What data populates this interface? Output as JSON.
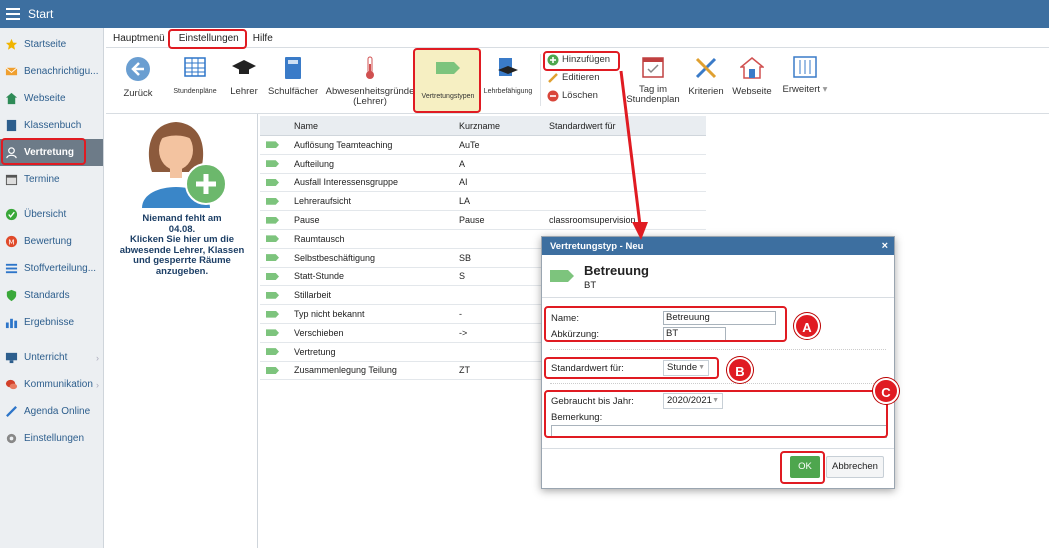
{
  "topbar": {
    "title": "Start"
  },
  "sidebar": {
    "items": [
      {
        "label": "Startseite",
        "icon": "star-icon",
        "color": "#f0b400"
      },
      {
        "label": "Benachrichtigu...",
        "icon": "mail-icon",
        "color": "#f0a030"
      },
      {
        "label": "Webseite",
        "icon": "home-icon",
        "color": "#2e8b57"
      },
      {
        "label": "Klassenbuch",
        "icon": "book-icon",
        "color": "#2d5e8d"
      },
      {
        "label": "Vertretung",
        "icon": "user-icon",
        "color": "#ffffff"
      },
      {
        "label": "Termine",
        "icon": "calendar-icon",
        "color": "#555555"
      },
      {
        "label": "Übersicht",
        "icon": "check-circle-icon",
        "color": "#3aa83a"
      },
      {
        "label": "Bewertung",
        "icon": "rating-icon",
        "color": "#e04a2a"
      },
      {
        "label": "Stoffverteilung...",
        "icon": "list-icon",
        "color": "#2d75c9"
      },
      {
        "label": "Standards",
        "icon": "shield-icon",
        "color": "#3aa83a"
      },
      {
        "label": "Ergebnisse",
        "icon": "bar-chart-icon",
        "color": "#2d75c9"
      },
      {
        "label": "Unterricht",
        "icon": "teaching-icon",
        "color": "#2d5e8d"
      },
      {
        "label": "Kommunikation",
        "icon": "chat-icon",
        "color": "#d2402a"
      },
      {
        "label": "Agenda Online",
        "icon": "pen-icon",
        "color": "#2d75c9"
      },
      {
        "label": "Einstellungen",
        "icon": "gear-icon",
        "color": "#888888"
      }
    ]
  },
  "menubar": {
    "items": [
      "Hauptmenü",
      "Einstellungen",
      "Hilfe"
    ]
  },
  "toolbar": {
    "back": "Zurück",
    "stundenplaene": "Stundenpläne",
    "lehrer": "Lehrer",
    "schulfaecher": "Schulfächer",
    "abwesenheit_1": "Abwesenheitsgründe",
    "abwesenheit_2": "(Lehrer)",
    "vertretungstypen": "Vertretungstypen",
    "lehrbefaehigung": "Lehrbefähigung",
    "hinzufuegen": "Hinzufügen",
    "editieren": "Editieren",
    "loeschen": "Löschen",
    "tag_1": "Tag im",
    "tag_2": "Stundenplan",
    "kriterien": "Kriterien",
    "webseite": "Webseite",
    "erweitert": "Erweitert"
  },
  "person_panel": {
    "line1": "Niemand fehlt am",
    "line2": "04.08.",
    "line3": "Klicken Sie hier um die",
    "line4": "abwesende Lehrer, Klassen",
    "line5": "und gesperrte Räume",
    "line6": "anzugeben."
  },
  "table": {
    "headers": [
      "Name",
      "Kurzname",
      "Standardwert für"
    ],
    "rows": [
      [
        "Auflösung Teamteaching",
        "AuTe",
        ""
      ],
      [
        "Aufteilung",
        "A",
        ""
      ],
      [
        "Ausfall Interessensgruppe",
        "AI",
        ""
      ],
      [
        "Lehreraufsicht",
        "LA",
        ""
      ],
      [
        "Pause",
        "Pause",
        "classroomsupervision"
      ],
      [
        "Raumtausch",
        "",
        ""
      ],
      [
        "Selbstbeschäftigung",
        "SB",
        ""
      ],
      [
        "Statt-Stunde",
        "S",
        ""
      ],
      [
        "Stillarbeit",
        "",
        ""
      ],
      [
        "Typ nicht bekannt",
        "-",
        ""
      ],
      [
        "Verschieben",
        "->",
        ""
      ],
      [
        "Vertretung",
        "",
        ""
      ],
      [
        "Zusammenlegung Teilung",
        "ZT",
        ""
      ]
    ]
  },
  "dialog": {
    "header": "Vertretungstyp - Neu",
    "close": "×",
    "title": "Betreuung",
    "subtitle": "BT",
    "name_label": "Name:",
    "name_value": "Betreuung",
    "abk_label": "Abkürzung:",
    "abk_value": "BT",
    "std_label": "Standardwert für:",
    "std_value": "Stunde",
    "jahr_label": "Gebraucht bis Jahr:",
    "jahr_value": "2020/2021",
    "bemerkung_label": "Bemerkung:",
    "bemerkung_value": "",
    "ok": "OK",
    "cancel": "Abbrechen"
  },
  "annotations": {
    "a": "A",
    "b": "B",
    "c": "C"
  },
  "colors": {
    "accent": "#3d6fa0",
    "highlight": "#e01b22",
    "ok": "#4ea64e"
  }
}
